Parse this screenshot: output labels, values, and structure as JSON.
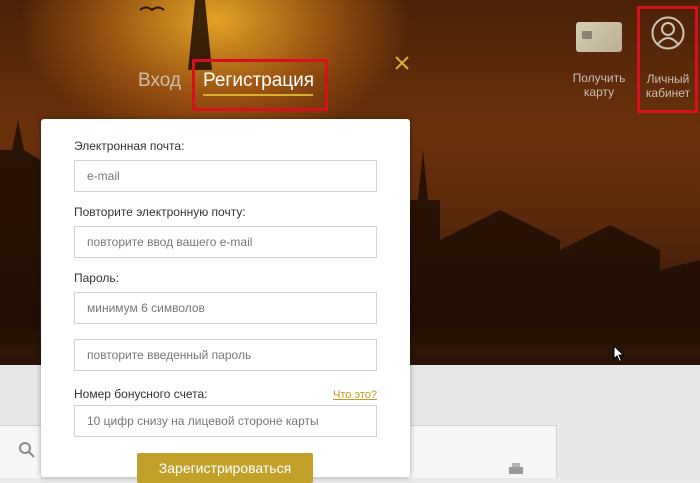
{
  "tabs": {
    "login_label": "Вход",
    "register_label": "Регистрация"
  },
  "header": {
    "get_card_label": "Получить карту",
    "cabinet_label": "Личный кабинет"
  },
  "form": {
    "email_label": "Электронная почта:",
    "email_placeholder": "e-mail",
    "repeat_email_label": "Повторите электронную почту:",
    "repeat_email_placeholder": "повторите ввод вашего e-mail",
    "password_label": "Пароль:",
    "password_placeholder": "минимум 6 символов",
    "repeat_password_placeholder": "повторите введенный пароль",
    "bonus_label": "Номер бонусного счета:",
    "bonus_help": "Что это?",
    "bonus_placeholder": "10 цифр снизу на лицевой стороне карты",
    "submit_label": "Зарегистрироваться"
  },
  "colors": {
    "accent_gold": "#c2a12a",
    "highlight_red": "#d7111b",
    "hero_dark": "#4a2208"
  },
  "icons": [
    "close-icon",
    "credit-card-icon",
    "user-avatar-icon",
    "search-icon",
    "print-icon",
    "mouse-cursor"
  ]
}
